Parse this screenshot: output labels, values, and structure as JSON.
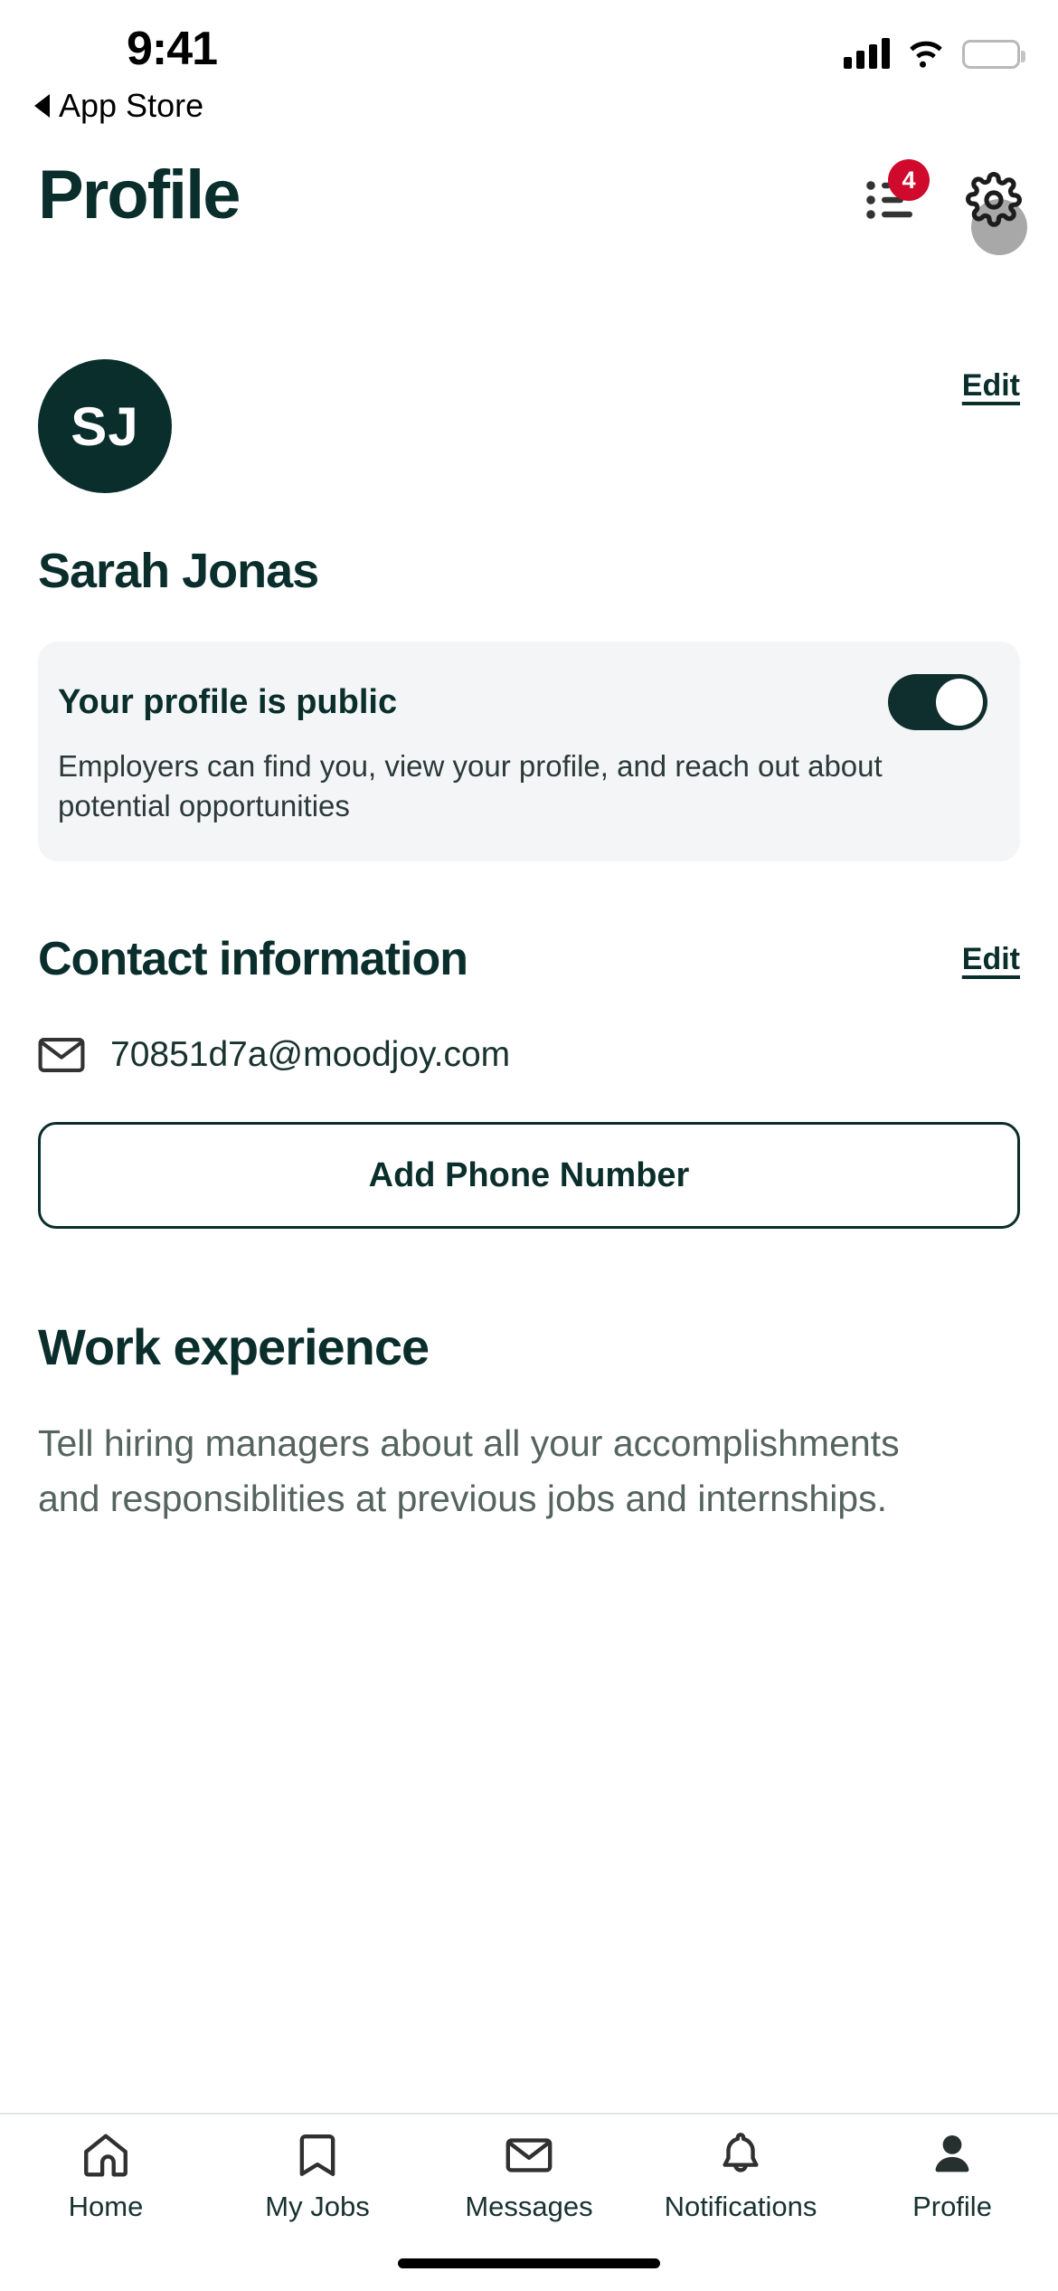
{
  "statusbar": {
    "time": "9:41",
    "back_label": "App Store",
    "signal_icon": "cellular-signal-icon",
    "wifi_icon": "wifi-icon",
    "battery_icon": "battery-full-icon"
  },
  "header": {
    "title": "Profile",
    "list_icon": "list-icon",
    "notifications_badge": "4",
    "settings_icon": "gear-icon"
  },
  "profile": {
    "avatar_initials": "SJ",
    "edit_label": "Edit",
    "name": "Sarah Jonas",
    "public_card": {
      "title": "Your profile is public",
      "description": "Employers can find you, view your profile, and reach out about potential opportunities",
      "toggle_state": "on"
    }
  },
  "contact": {
    "title": "Contact information",
    "edit_label": "Edit",
    "email_icon": "envelope-icon",
    "email": "70851d7a@moodjoy.com",
    "add_phone_label": "Add Phone Number"
  },
  "work": {
    "title": "Work experience",
    "description": "Tell hiring managers about all your accomplishments and responsiblities at previous jobs and internships."
  },
  "tabbar": {
    "items": [
      {
        "label": "Home",
        "icon": "home-icon",
        "active": false
      },
      {
        "label": "My Jobs",
        "icon": "bookmark-icon",
        "active": false
      },
      {
        "label": "Messages",
        "icon": "envelope-icon",
        "active": false
      },
      {
        "label": "Notifications",
        "icon": "bell-icon",
        "active": false
      },
      {
        "label": "Profile",
        "icon": "person-icon",
        "active": true
      }
    ]
  },
  "colors": {
    "brand_dark": "#0a2e2c",
    "badge_red": "#cf0a2c",
    "card_bg": "#f4f5f6",
    "muted_text": "#55645f"
  }
}
